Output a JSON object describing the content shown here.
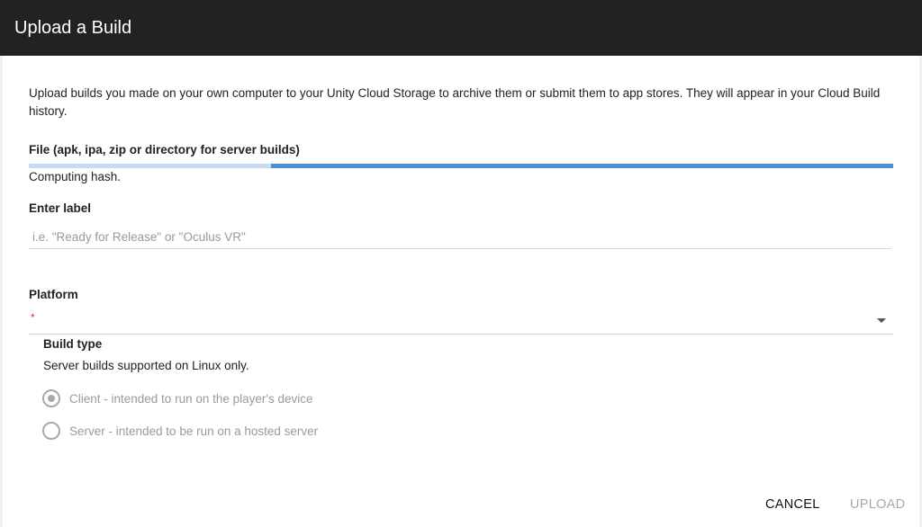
{
  "dialog": {
    "title": "Upload a Build",
    "intro": "Upload builds you made on your own computer to your Unity Cloud Storage to archive them or submit them to app stores. They will appear in your Cloud Build history."
  },
  "file": {
    "label": "File (apk, ipa, zip or directory for server builds)",
    "progress_fraction": 0.28,
    "status": "Computing hash."
  },
  "label_field": {
    "label": "Enter label",
    "value": "",
    "placeholder": "i.e. \"Ready for Release\" or \"Oculus VR\""
  },
  "platform": {
    "label": "Platform",
    "required_mark": "*",
    "selected": ""
  },
  "build_type": {
    "label": "Build type",
    "note": "Server builds supported on Linux only.",
    "options": [
      {
        "label": "Client - intended to run on the player's device",
        "selected": true,
        "disabled": true
      },
      {
        "label": "Server - intended to be run on a hosted server",
        "selected": false,
        "disabled": true
      }
    ]
  },
  "actions": {
    "cancel_label": "CANCEL",
    "upload_label": "UPLOAD",
    "upload_enabled": false
  },
  "colors": {
    "titlebar": "#222222",
    "progress_track": "#c5dbf3",
    "progress_fill": "#4a8fd4",
    "required": "#d0342c",
    "disabled_text": "#9a9a9a"
  }
}
